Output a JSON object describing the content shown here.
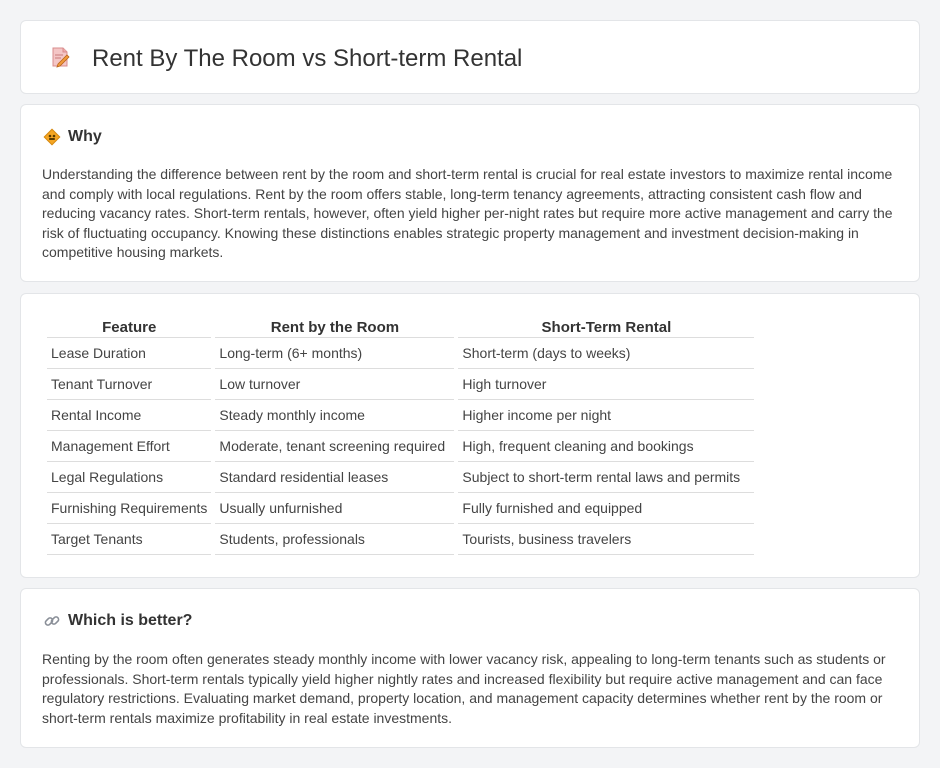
{
  "header": {
    "title": "Rent By The Room vs Short-term Rental",
    "icon": "document-pencil-icon"
  },
  "why": {
    "heading": "Why",
    "icon": "diamond-sign-icon",
    "text": "Understanding the difference between rent by the room and short-term rental is crucial for real estate investors to maximize rental income and comply with local regulations. Rent by the room offers stable, long-term tenancy agreements, attracting consistent cash flow and reducing vacancy rates. Short-term rentals, however, often yield higher per-night rates but require more active management and carry the risk of fluctuating occupancy. Knowing these distinctions enables strategic property management and investment decision-making in competitive housing markets."
  },
  "comparison": {
    "columns": [
      "Feature",
      "Rent by the Room",
      "Short-Term Rental"
    ],
    "rows": [
      [
        "Lease Duration",
        "Long-term (6+ months)",
        "Short-term (days to weeks)"
      ],
      [
        "Tenant Turnover",
        "Low turnover",
        "High turnover"
      ],
      [
        "Rental Income",
        "Steady monthly income",
        "Higher income per night"
      ],
      [
        "Management Effort",
        "Moderate, tenant screening required",
        "High, frequent cleaning and bookings"
      ],
      [
        "Legal Regulations",
        "Standard residential leases",
        "Subject to short-term rental laws and permits"
      ],
      [
        "Furnishing Requirements",
        "Usually unfurnished",
        "Fully furnished and equipped"
      ],
      [
        "Target Tenants",
        "Students, professionals",
        "Tourists, business travelers"
      ]
    ]
  },
  "better": {
    "heading": "Which is better?",
    "icon": "link-icon",
    "text": "Renting by the room often generates steady monthly income with lower vacancy risk, appealing to long-term tenants such as students or professionals. Short-term rentals typically yield higher nightly rates and increased flexibility but require active management and can face regulatory restrictions. Evaluating market demand, property location, and management capacity determines whether rent by the room or short-term rentals maximize profitability in real estate investments."
  },
  "colors": {
    "background": "#f3f4f6",
    "card": "#ffffff",
    "border": "#e3e5e8",
    "accent_orange": "#f0a030",
    "text": "#333333"
  }
}
